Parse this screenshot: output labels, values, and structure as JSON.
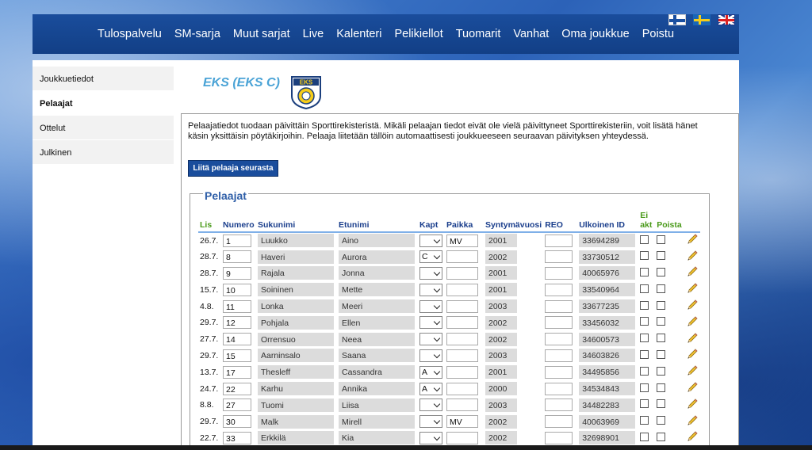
{
  "nav": {
    "items": [
      "Tulospalvelu",
      "SM-sarja",
      "Muut sarjat",
      "Live",
      "Kalenteri",
      "Pelikiellot",
      "Tuomarit",
      "Vanhat",
      "Oma joukkue",
      "Poistu"
    ]
  },
  "languages": [
    "fi",
    "se",
    "gb"
  ],
  "sidebar": {
    "items": [
      {
        "label": "Joukkuetiedot",
        "active": false
      },
      {
        "label": "Pelaajat",
        "active": true
      },
      {
        "label": "Ottelut",
        "active": false
      },
      {
        "label": "Julkinen",
        "active": false
      }
    ]
  },
  "team": {
    "title": "EKS (EKS C)",
    "logo_text": "EKS"
  },
  "intro_text": "Pelaajatiedot tuodaan päivittäin Sporttirekisteristä. Mikäli pelaajan tiedot eivät ole vielä päivittyneet Sporttirekisteriin, voit lisätä hänet käsin yksittäisin pöytäkirjoihin. Pelaaja liitetään tällöin automaattisesti joukkueeseen seuraavan päivityksen yhteydessä.",
  "add_button_label": "Liitä pelaaja seurasta",
  "players_section": {
    "legend": "Pelaajat",
    "columns": {
      "lis": "Lis",
      "numero": "Numero",
      "sukunimi": "Sukunimi",
      "etunimi": "Etunimi",
      "kapt": "Kapt",
      "paikka": "Paikka",
      "syntymavuosi": "Syntymävuosi",
      "reo": "REO",
      "ulkoinen_id": "Ulkoinen ID",
      "ei_akt_1": "Ei",
      "ei_akt_2": "akt",
      "poista": "Poista"
    },
    "rows": [
      {
        "lis": "26.7.",
        "numero": "1",
        "sukunimi": "Luukko",
        "etunimi": "Aino",
        "kapt": "",
        "paikka": "MV",
        "vuosi": "2001",
        "reo": "",
        "id": "33694289"
      },
      {
        "lis": "28.7.",
        "numero": "8",
        "sukunimi": "Haveri",
        "etunimi": "Aurora",
        "kapt": "C",
        "paikka": "",
        "vuosi": "2002",
        "reo": "",
        "id": "33730512"
      },
      {
        "lis": "28.7.",
        "numero": "9",
        "sukunimi": "Rajala",
        "etunimi": "Jonna",
        "kapt": "",
        "paikka": "",
        "vuosi": "2001",
        "reo": "",
        "id": "40065976"
      },
      {
        "lis": "15.7.",
        "numero": "10",
        "sukunimi": "Soininen",
        "etunimi": "Mette",
        "kapt": "",
        "paikka": "",
        "vuosi": "2001",
        "reo": "",
        "id": "33540964"
      },
      {
        "lis": "4.8.",
        "numero": "11",
        "sukunimi": "Lonka",
        "etunimi": "Meeri",
        "kapt": "",
        "paikka": "",
        "vuosi": "2003",
        "reo": "",
        "id": "33677235"
      },
      {
        "lis": "29.7.",
        "numero": "12",
        "sukunimi": "Pohjala",
        "etunimi": "Ellen",
        "kapt": "",
        "paikka": "",
        "vuosi": "2002",
        "reo": "",
        "id": "33456032"
      },
      {
        "lis": "27.7.",
        "numero": "14",
        "sukunimi": "Orrensuo",
        "etunimi": "Neea",
        "kapt": "",
        "paikka": "",
        "vuosi": "2002",
        "reo": "",
        "id": "34600573"
      },
      {
        "lis": "29.7.",
        "numero": "15",
        "sukunimi": "Aarninsalo",
        "etunimi": "Saana",
        "kapt": "",
        "paikka": "",
        "vuosi": "2003",
        "reo": "",
        "id": "34603826"
      },
      {
        "lis": "13.7.",
        "numero": "17",
        "sukunimi": "Thesleff",
        "etunimi": "Cassandra",
        "kapt": "A",
        "paikka": "",
        "vuosi": "2001",
        "reo": "",
        "id": "34495856"
      },
      {
        "lis": "24.7.",
        "numero": "22",
        "sukunimi": "Karhu",
        "etunimi": "Annika",
        "kapt": "A",
        "paikka": "",
        "vuosi": "2000",
        "reo": "",
        "id": "34534843"
      },
      {
        "lis": "8.8.",
        "numero": "27",
        "sukunimi": "Tuomi",
        "etunimi": "Liisa",
        "kapt": "",
        "paikka": "",
        "vuosi": "2003",
        "reo": "",
        "id": "34482283"
      },
      {
        "lis": "29.7.",
        "numero": "30",
        "sukunimi": "Malk",
        "etunimi": "Mirell",
        "kapt": "",
        "paikka": "MV",
        "vuosi": "2002",
        "reo": "",
        "id": "40063969"
      },
      {
        "lis": "22.7.",
        "numero": "33",
        "sukunimi": "Erkkilä",
        "etunimi": "Kia",
        "kapt": "",
        "paikka": "",
        "vuosi": "2002",
        "reo": "",
        "id": "32698901"
      }
    ]
  },
  "colors": {
    "nav_bg": "#1a4d9c",
    "team_title": "#4aa3d6",
    "header_text": "#1a3e8c",
    "header_green": "#4a9a1a"
  }
}
